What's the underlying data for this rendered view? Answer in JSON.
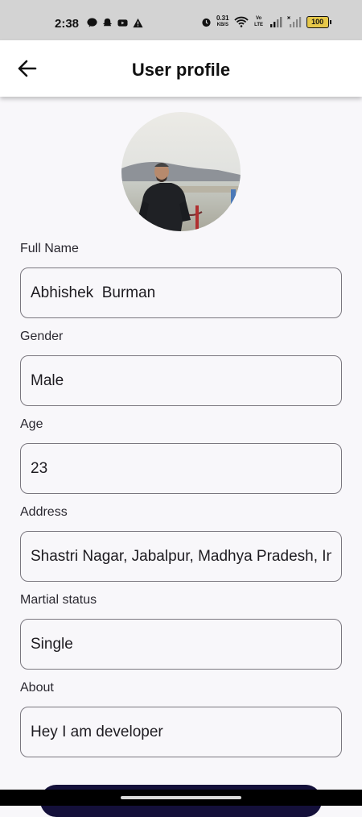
{
  "status_bar": {
    "time": "2:38",
    "net_speed_value": "0.31",
    "net_speed_unit": "KB/S",
    "volte": "Vo LTE",
    "battery": "100",
    "icons": [
      "chat-icon",
      "snapchat-icon",
      "youtube-icon",
      "warning-icon",
      "alarm-icon",
      "wifi-icon",
      "signal-icon",
      "signal-x-icon"
    ]
  },
  "app_bar": {
    "title": "User profile",
    "back_icon": "arrow-left-icon"
  },
  "profile": {
    "fields": [
      {
        "label": "Full Name",
        "value": "Abhishek  Burman"
      },
      {
        "label": "Gender",
        "value": "Male"
      },
      {
        "label": "Age",
        "value": "23"
      },
      {
        "label": "Address",
        "value": "Shastri Nagar, Jabalpur, Madhya Pradesh, India"
      },
      {
        "label": "Martial status",
        "value": "Single"
      },
      {
        "label": "About",
        "value": "Hey I am developer"
      }
    ]
  },
  "colors": {
    "background": "#f8f7fa",
    "status_bar": "#d3d3d3",
    "field_border": "#7a777f",
    "button": "#14103a",
    "battery": "#e6c84a"
  }
}
